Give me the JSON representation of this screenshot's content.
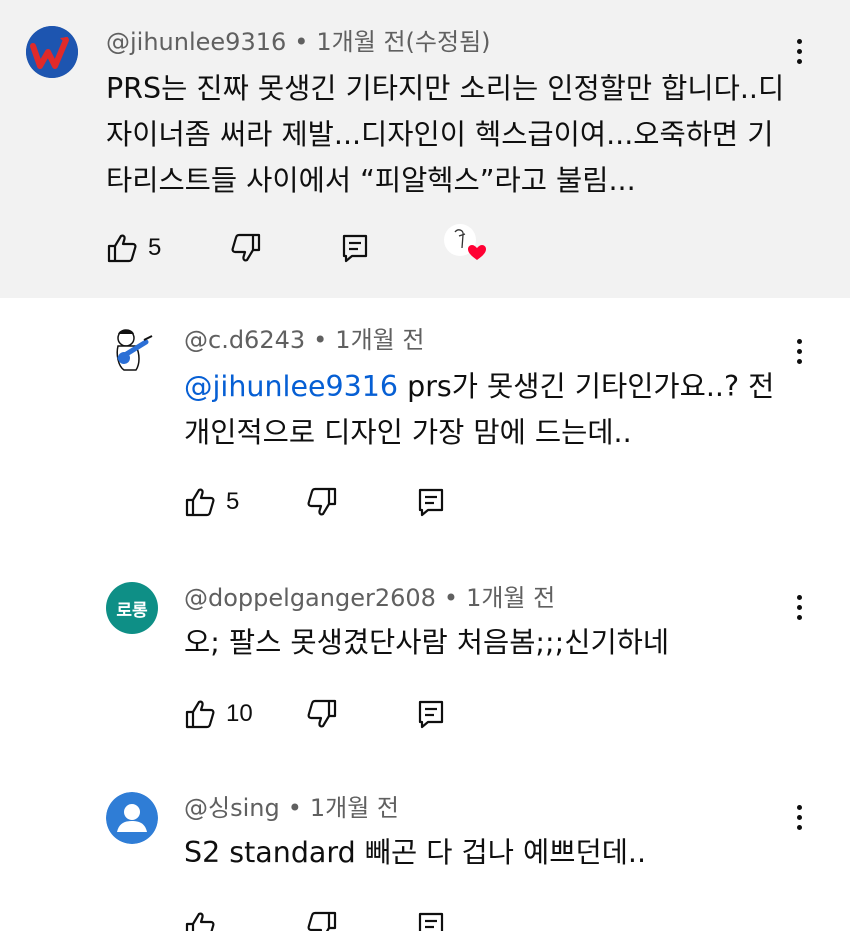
{
  "comments": [
    {
      "handle": "@jihunlee9316",
      "separator": "•",
      "time": "1개월 전(수정됨)",
      "lines": [
        "PRS는 진짜 못생긴 기타지만 소리는 인정할만 합니다..디",
        "자이너좀 써라 제발...디자인이 헥스급이여...오죽하면 기",
        "타리스트들 사이에서 “피알헥스”라고 불림..."
      ],
      "likes": "5",
      "avatar_icon": "trend-logo-icon",
      "creator_heart": true
    },
    {
      "handle": "@c.d6243",
      "separator": "•",
      "time": "1개월 전",
      "mention": "@jihunlee9316",
      "line1_rest": " prs가 못생긴 기타인가요..? 전",
      "line2": "개인적으로 디자인 가장 맘에 드는데..",
      "likes": "5",
      "avatar_icon": "guitar-cartoon-icon"
    },
    {
      "handle": "@doppelganger2608",
      "separator": "•",
      "time": "1개월 전",
      "line1": "오; 팔스 못생겼단사람 처음봄;;;신기하네",
      "likes": "10",
      "avatar_text": "로롱"
    },
    {
      "handle": "@싱sing",
      "separator": "•",
      "time": "1개월 전",
      "line1": "S2 standard 빼곤 다 겁나 예쁘던데..",
      "likes": "",
      "avatar_icon": "default-person-icon"
    }
  ],
  "colors": {
    "highlight_bg": "#f2f2f2",
    "mention": "#065fd4",
    "meta_text": "#606060",
    "rolong_avatar": "#0e8f86",
    "heart": "#ff0033"
  }
}
